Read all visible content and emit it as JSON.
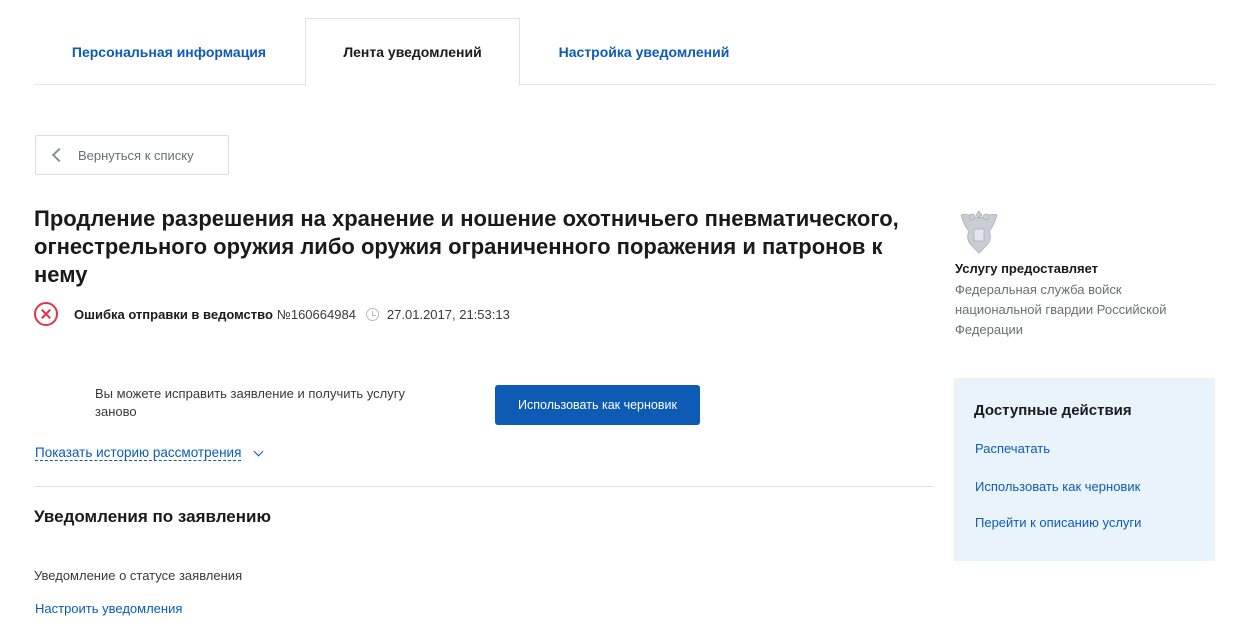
{
  "tabs": [
    {
      "label": "Персональная информация"
    },
    {
      "label": "Лента уведомлений"
    },
    {
      "label": "Настройка уведомлений"
    }
  ],
  "back_button": {
    "label": "Вернуться к списку"
  },
  "application": {
    "title": "Продление разрешения на хранение и ношение охотничьего пневматического, огнестрельного оружия либо оружия ограниченного поражения и патронов к нему",
    "status_text": "Ошибка отправки в ведомство",
    "number": "№160664984",
    "datetime": "27.01.2017, 21:53:13"
  },
  "draft": {
    "note": "Вы можете исправить заявление и получить услугу заново",
    "button_label": "Использовать как черновик"
  },
  "history_link": "Показать историю рассмотрения",
  "notifications": {
    "title": "Уведомления по заявлению",
    "status_label": "Уведомление о статусе заявления",
    "settings_link": "Настроить уведомления"
  },
  "provider": {
    "label": "Услугу предоставляет",
    "name": "Федеральная служба войск национальной гвардии Российской Федерации"
  },
  "actions": {
    "title": "Доступные действия",
    "items": [
      {
        "label": "Распечатать"
      },
      {
        "label": "Использовать как черновик"
      },
      {
        "label": "Перейти к описанию услуги"
      }
    ]
  },
  "colors": {
    "link": "#0d5bb5",
    "primary_button": "#0d5bb5",
    "error": "#e2334a",
    "actions_panel_bg": "#e9f3fc"
  },
  "icons": [
    "chevron-left-icon",
    "error-circle-icon",
    "clock-icon",
    "chevron-down-icon",
    "emblem-icon"
  ]
}
